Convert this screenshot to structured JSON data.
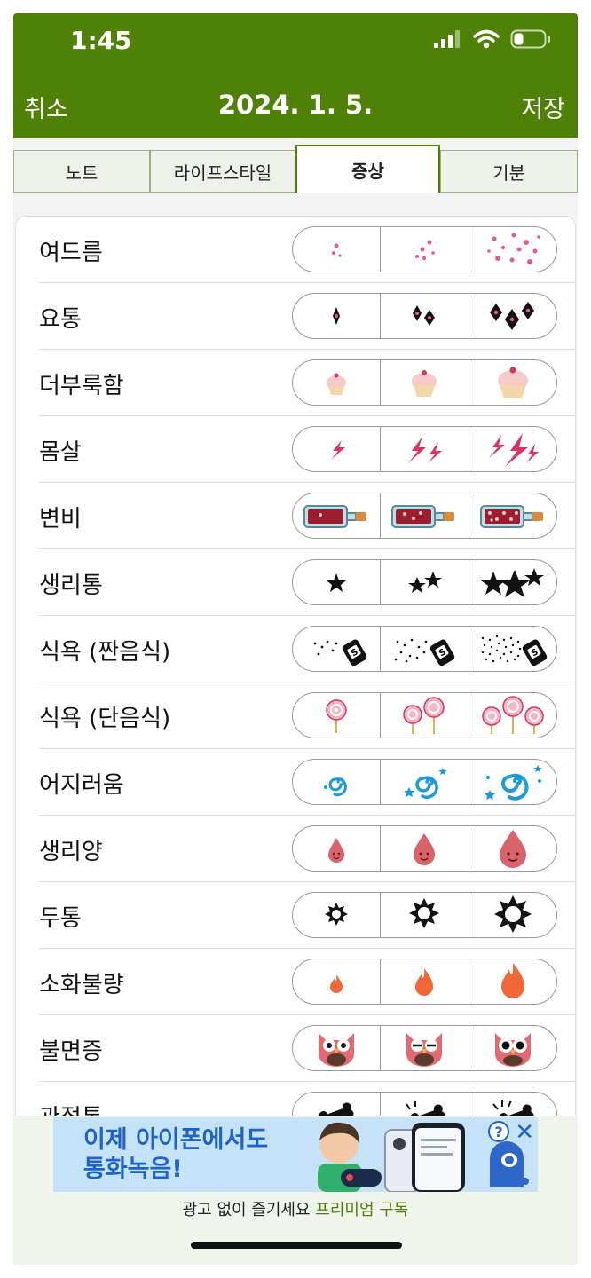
{
  "status_bar": {
    "time": "1:45"
  },
  "nav": {
    "cancel": "취소",
    "title": "2024. 1. 5.",
    "save": "저장"
  },
  "tabs": [
    {
      "label": "노트",
      "active": false
    },
    {
      "label": "라이프스타일",
      "active": false
    },
    {
      "label": "증상",
      "active": true
    },
    {
      "label": "기분",
      "active": false
    }
  ],
  "symptoms": [
    {
      "label": "여드름",
      "icon": "acne-dots-icon"
    },
    {
      "label": "요통",
      "icon": "sparkle-icon"
    },
    {
      "label": "더부룩함",
      "icon": "cupcake-icon"
    },
    {
      "label": "몸살",
      "icon": "lightning-icon"
    },
    {
      "label": "변비",
      "icon": "bottle-icon"
    },
    {
      "label": "생리통",
      "icon": "star-icon"
    },
    {
      "label": "식욕 (짠음식)",
      "icon": "salt-shaker-icon"
    },
    {
      "label": "식욕 (단음식)",
      "icon": "lollipop-icon"
    },
    {
      "label": "어지러움",
      "icon": "swirl-icon"
    },
    {
      "label": "생리양",
      "icon": "blood-drop-icon"
    },
    {
      "label": "두통",
      "icon": "burst-icon"
    },
    {
      "label": "소화불량",
      "icon": "flame-icon"
    },
    {
      "label": "불면증",
      "icon": "owl-icon"
    },
    {
      "label": "관절통",
      "icon": "bone-icon"
    }
  ],
  "ad": {
    "line1": "이제 아이폰에서도",
    "line2": "통화녹음!",
    "help": "?",
    "close": "✕",
    "caption": "광고 없이 즐기세요",
    "premium": "프리미엄 구독"
  },
  "colors": {
    "header_green": "#4f8106",
    "acne_pink": "#e8589a",
    "dizzy_blue": "#1a9cd8",
    "drop_red": "#d9636b",
    "flame_orange": "#f0683a"
  }
}
